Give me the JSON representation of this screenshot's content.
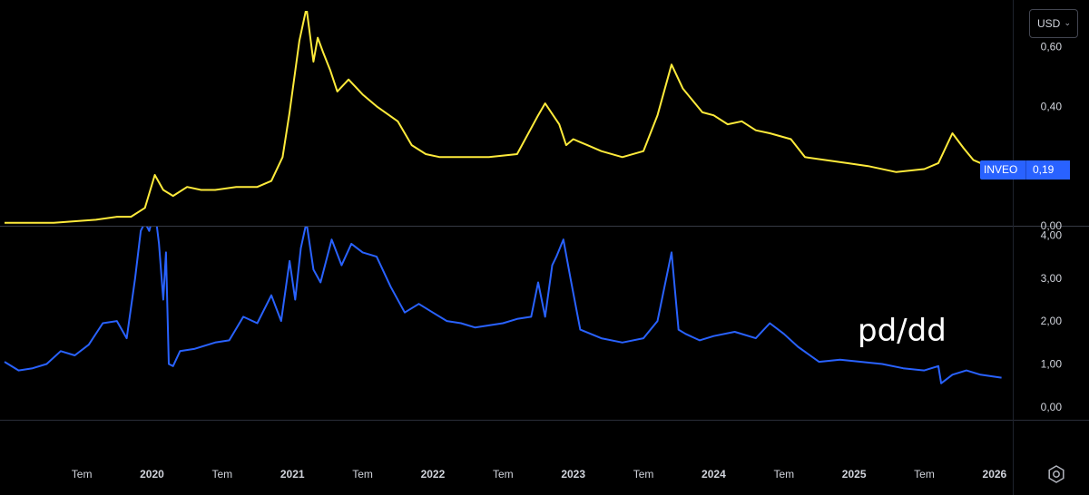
{
  "currency": {
    "label": "USD"
  },
  "annotation": "pd/dd",
  "price_tag": {
    "name": "INVEO",
    "value": "0,19"
  },
  "colors": {
    "price": "#ffeb3b",
    "ratio": "#2962ff",
    "tag": "#2962ff",
    "background": "#000000",
    "divider": "#363a45"
  },
  "icons": {
    "currency_chevron": "chevron-down-icon",
    "settings": "gear-icon"
  },
  "x_axis": {
    "labels": [
      "Tem",
      "2020",
      "Tem",
      "2021",
      "Tem",
      "2022",
      "Tem",
      "2023",
      "Tem",
      "2024",
      "Tem",
      "2025",
      "Tem",
      "2026"
    ],
    "positions": [
      2019.5,
      2020.0,
      2020.5,
      2021.0,
      2021.5,
      2022.0,
      2022.5,
      2023.0,
      2023.5,
      2024.0,
      2024.5,
      2025.0,
      2025.5,
      2026.0
    ]
  },
  "chart_data": [
    {
      "type": "line",
      "ylim": [
        0,
        0.72
      ],
      "y_ticks": [
        "0,00",
        "0,20",
        "0,40",
        "0,60"
      ],
      "y_tick_values": [
        0,
        0.2,
        0.4,
        0.6
      ],
      "series": [
        {
          "name": "INVEO",
          "x": [
            2018.95,
            2019.3,
            2019.6,
            2019.75,
            2019.85,
            2019.95,
            2020.02,
            2020.08,
            2020.15,
            2020.25,
            2020.35,
            2020.45,
            2020.6,
            2020.75,
            2020.85,
            2020.93,
            2020.98,
            2021.05,
            2021.1,
            2021.15,
            2021.18,
            2021.22,
            2021.27,
            2021.32,
            2021.4,
            2021.5,
            2021.6,
            2021.75,
            2021.85,
            2021.95,
            2022.05,
            2022.2,
            2022.4,
            2022.6,
            2022.75,
            2022.8,
            2022.9,
            2022.95,
            2023.0,
            2023.05,
            2023.1,
            2023.2,
            2023.35,
            2023.5,
            2023.6,
            2023.7,
            2023.78,
            2023.85,
            2023.92,
            2024.0,
            2024.1,
            2024.2,
            2024.3,
            2024.4,
            2024.55,
            2024.65,
            2024.8,
            2024.95,
            2025.1,
            2025.3,
            2025.5,
            2025.6,
            2025.7,
            2025.78,
            2025.85,
            2025.95,
            2026.05
          ],
          "values": [
            0.01,
            0.01,
            0.02,
            0.03,
            0.03,
            0.06,
            0.17,
            0.12,
            0.1,
            0.13,
            0.12,
            0.12,
            0.13,
            0.13,
            0.15,
            0.23,
            0.38,
            0.62,
            0.73,
            0.55,
            0.63,
            0.58,
            0.52,
            0.45,
            0.49,
            0.44,
            0.4,
            0.35,
            0.27,
            0.24,
            0.23,
            0.23,
            0.23,
            0.24,
            0.37,
            0.41,
            0.34,
            0.27,
            0.29,
            0.28,
            0.27,
            0.25,
            0.23,
            0.25,
            0.37,
            0.54,
            0.46,
            0.42,
            0.38,
            0.37,
            0.34,
            0.35,
            0.32,
            0.31,
            0.29,
            0.23,
            0.22,
            0.21,
            0.2,
            0.18,
            0.19,
            0.21,
            0.31,
            0.26,
            0.22,
            0.2,
            0.19
          ]
        }
      ]
    },
    {
      "type": "line",
      "ylim": [
        -0.3,
        4.2
      ],
      "y_ticks": [
        "0,00",
        "1,00",
        "2,00",
        "3,00",
        "4,00"
      ],
      "y_tick_values": [
        0,
        1,
        2,
        3,
        4
      ],
      "series": [
        {
          "name": "pd/dd",
          "x": [
            2018.95,
            2019.05,
            2019.15,
            2019.25,
            2019.35,
            2019.45,
            2019.55,
            2019.65,
            2019.75,
            2019.82,
            2019.88,
            2019.92,
            2019.95,
            2019.98,
            2020.02,
            2020.05,
            2020.08,
            2020.1,
            2020.12,
            2020.15,
            2020.2,
            2020.3,
            2020.45,
            2020.55,
            2020.65,
            2020.75,
            2020.85,
            2020.92,
            2020.98,
            2021.02,
            2021.06,
            2021.1,
            2021.15,
            2021.2,
            2021.28,
            2021.35,
            2021.42,
            2021.5,
            2021.6,
            2021.7,
            2021.8,
            2021.9,
            2022.0,
            2022.1,
            2022.2,
            2022.3,
            2022.4,
            2022.5,
            2022.6,
            2022.7,
            2022.75,
            2022.8,
            2022.85,
            2022.88,
            2022.93,
            2022.98,
            2023.05,
            2023.2,
            2023.35,
            2023.5,
            2023.6,
            2023.7,
            2023.75,
            2023.8,
            2023.9,
            2024.0,
            2024.15,
            2024.3,
            2024.4,
            2024.5,
            2024.6,
            2024.75,
            2024.9,
            2025.05,
            2025.2,
            2025.35,
            2025.5,
            2025.6,
            2025.62,
            2025.7,
            2025.8,
            2025.9,
            2026.05
          ],
          "values": [
            1.05,
            0.85,
            0.9,
            1.0,
            1.3,
            1.2,
            1.45,
            1.95,
            2.0,
            1.6,
            3.0,
            4.1,
            4.3,
            4.1,
            4.6,
            3.8,
            2.5,
            3.6,
            1.0,
            0.95,
            1.3,
            1.35,
            1.5,
            1.55,
            2.1,
            1.95,
            2.6,
            2.0,
            3.4,
            2.5,
            3.7,
            4.3,
            3.2,
            2.9,
            3.9,
            3.3,
            3.8,
            3.6,
            3.5,
            2.8,
            2.2,
            2.4,
            2.2,
            2.0,
            1.95,
            1.85,
            1.9,
            1.95,
            2.05,
            2.1,
            2.9,
            2.1,
            3.3,
            3.5,
            3.9,
            3.0,
            1.8,
            1.6,
            1.5,
            1.6,
            2.0,
            3.6,
            1.8,
            1.7,
            1.55,
            1.65,
            1.75,
            1.6,
            1.95,
            1.7,
            1.4,
            1.05,
            1.1,
            1.05,
            1.0,
            0.9,
            0.85,
            0.95,
            0.55,
            0.75,
            0.85,
            0.75,
            0.68
          ]
        }
      ]
    }
  ]
}
